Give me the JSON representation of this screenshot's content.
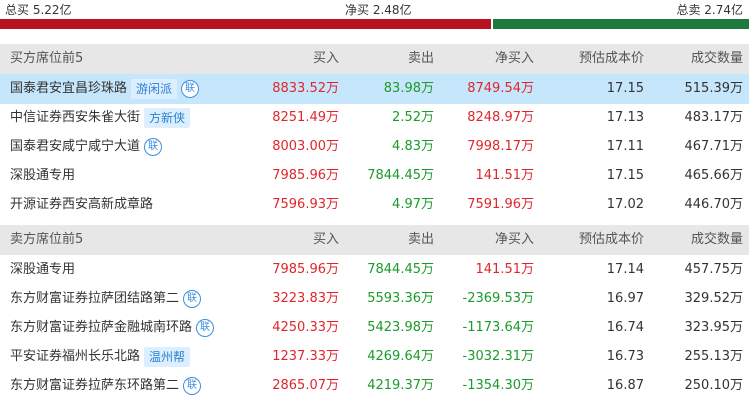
{
  "summary": {
    "total_buy": "总买 5.22亿",
    "net_buy": "净买 2.48亿",
    "total_sell": "总卖 2.74亿",
    "buy_ratio": 0.655,
    "colors": {
      "buy": "#b8121e",
      "sell": "#1d7a3d"
    }
  },
  "columns": {
    "buy": "买入",
    "sell": "卖出",
    "net": "净买入",
    "cost": "预估成本价",
    "volume": "成交数量"
  },
  "buy_section": {
    "title": "买方席位前5",
    "rows": [
      {
        "name": "国泰君安宜昌珍珠路",
        "tag": "游闲派",
        "icon": "联",
        "buy": "8833.52万",
        "sell": "83.98万",
        "net": "8749.54万",
        "cost": "17.15",
        "volume": "515.39万",
        "highlight": true
      },
      {
        "name": "中信证券西安朱雀大街",
        "tag": "方新侠",
        "icon": "",
        "buy": "8251.49万",
        "sell": "2.52万",
        "net": "8248.97万",
        "cost": "17.13",
        "volume": "483.17万"
      },
      {
        "name": "国泰君安咸宁咸宁大道",
        "tag": "",
        "icon": "联",
        "buy": "8003.00万",
        "sell": "4.83万",
        "net": "7998.17万",
        "cost": "17.11",
        "volume": "467.71万"
      },
      {
        "name": "深股通专用",
        "tag": "",
        "icon": "",
        "buy": "7985.96万",
        "sell": "7844.45万",
        "net": "141.51万",
        "cost": "17.15",
        "volume": "465.66万"
      },
      {
        "name": "开源证券西安高新成章路",
        "tag": "",
        "icon": "",
        "buy": "7596.93万",
        "sell": "4.97万",
        "net": "7591.96万",
        "cost": "17.02",
        "volume": "446.70万"
      }
    ]
  },
  "sell_section": {
    "title": "卖方席位前5",
    "rows": [
      {
        "name": "深股通专用",
        "tag": "",
        "icon": "",
        "buy": "7985.96万",
        "sell": "7844.45万",
        "net": "141.51万",
        "cost": "17.14",
        "volume": "457.75万"
      },
      {
        "name": "东方财富证券拉萨团结路第二",
        "tag": "",
        "icon": "联",
        "buy": "3223.83万",
        "sell": "5593.36万",
        "net": "-2369.53万",
        "cost": "16.97",
        "volume": "329.52万"
      },
      {
        "name": "东方财富证券拉萨金融城南环路",
        "tag": "",
        "icon": "联",
        "buy": "4250.33万",
        "sell": "5423.98万",
        "net": "-1173.64万",
        "cost": "16.74",
        "volume": "323.95万"
      },
      {
        "name": "平安证券福州长乐北路",
        "tag": "温州帮",
        "icon": "",
        "buy": "1237.33万",
        "sell": "4269.64万",
        "net": "-3032.31万",
        "cost": "16.73",
        "volume": "255.13万"
      },
      {
        "name": "东方财富证券拉萨东环路第二",
        "tag": "",
        "icon": "联",
        "buy": "2865.07万",
        "sell": "4219.37万",
        "net": "-1354.30万",
        "cost": "16.87",
        "volume": "250.10万"
      }
    ]
  }
}
